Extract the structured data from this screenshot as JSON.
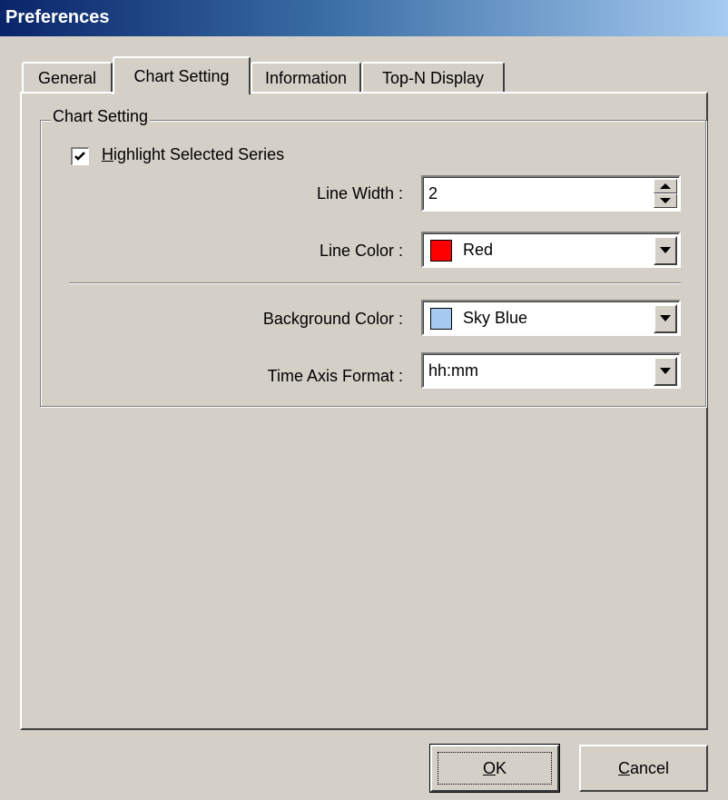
{
  "window": {
    "title": "Preferences"
  },
  "tabs": [
    {
      "label": "General",
      "active": false
    },
    {
      "label": "Chart Setting",
      "active": true
    },
    {
      "label": "Information",
      "active": false
    },
    {
      "label": "Top-N Display",
      "active": false
    }
  ],
  "chart_setting": {
    "group_title": "Chart Setting",
    "highlight": {
      "label_accel": "H",
      "label_rest": "ighlight Selected Series",
      "checked": true
    },
    "line_width": {
      "label": "Line Width :",
      "value": "2"
    },
    "line_color": {
      "label": "Line Color :",
      "value": "Red",
      "swatch": "#ff0000"
    },
    "background_color": {
      "label": "Background Color :",
      "value": "Sky Blue",
      "swatch": "#a6caf0"
    },
    "time_axis_format": {
      "label": "Time Axis Format :",
      "value": "hh:mm"
    }
  },
  "buttons": {
    "ok": {
      "accel": "O",
      "rest": "K"
    },
    "cancel": {
      "accel": "C",
      "rest": "ancel"
    }
  },
  "icons": {
    "check": "check-mark-icon",
    "dropdown": "chevron-down-icon",
    "spin_up": "arrow-up-icon",
    "spin_down": "arrow-down-icon"
  }
}
